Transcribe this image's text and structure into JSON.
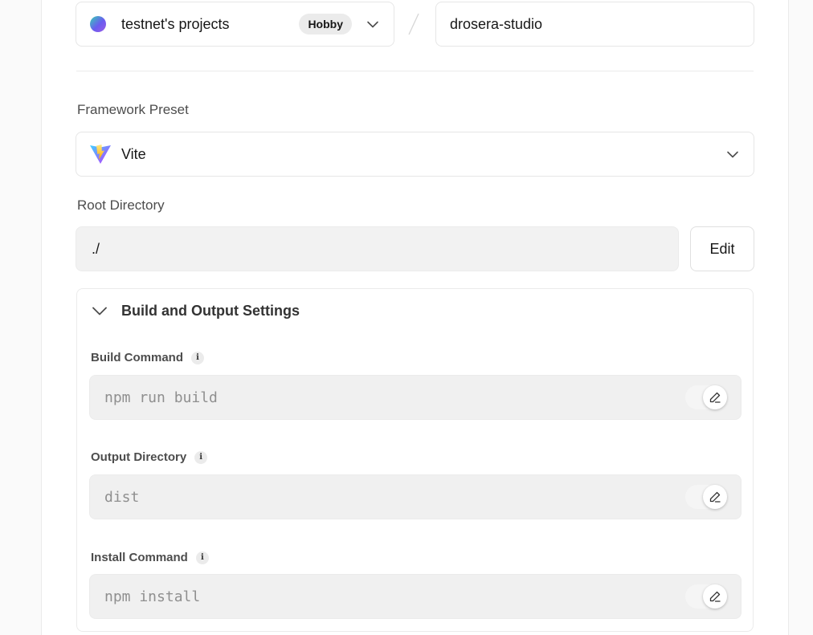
{
  "team": {
    "name": "testnet's projects",
    "plan_badge": "Hobby",
    "avatar_icon": "gradient-avatar"
  },
  "project": {
    "name_value": "drosera-studio"
  },
  "framework": {
    "label": "Framework Preset",
    "selected": "Vite",
    "icon": "vite-logo-icon"
  },
  "root_directory": {
    "label": "Root Directory",
    "value": "./",
    "edit_label": "Edit"
  },
  "build_settings": {
    "title": "Build and Output Settings",
    "expanded": true,
    "fields": [
      {
        "label": "Build Command",
        "value": "npm run build",
        "override_enabled": false
      },
      {
        "label": "Output Directory",
        "value": "dist",
        "override_enabled": false
      },
      {
        "label": "Install Command",
        "value": "npm install",
        "override_enabled": false
      }
    ]
  },
  "icons": {
    "info": "i",
    "info_icon": "info-icon",
    "edit_icon": "pencil-icon",
    "chevron": "chevron-down-icon"
  },
  "colors": {
    "border": "#ebebeb",
    "field_bg": "#f0f0f0",
    "text": "#171717",
    "muted_text": "#8f8f8f",
    "label_text": "#4d4d4d"
  }
}
